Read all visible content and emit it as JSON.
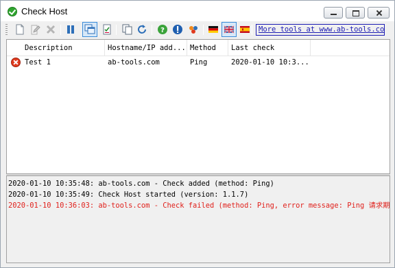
{
  "window": {
    "title": "Check Host"
  },
  "toolbar": {
    "buttons": [
      "new-document-icon",
      "edit-icon",
      "delete-icon",
      "pause-icon",
      "windows-icon",
      "checklist-icon",
      "copy-icon",
      "refresh-icon",
      "help-icon",
      "info-icon",
      "heart-icon",
      "flag-germany-icon",
      "flag-uk-icon",
      "flag-spain-icon"
    ],
    "active": [
      "windows-icon",
      "flag-uk-icon"
    ],
    "link_text": "More tools at www.ab-tools.com"
  },
  "list": {
    "columns": [
      "Description",
      "Hostname/IP add...",
      "Method",
      "Last check"
    ],
    "rows": [
      {
        "status": "error",
        "description": "Test 1",
        "host": "ab-tools.com",
        "method": "Ping",
        "last_check": "2020-01-10 10:3..."
      }
    ]
  },
  "log": {
    "lines": [
      {
        "text": "2020-01-10 10:35:48: ab-tools.com - Check added (method: Ping)",
        "level": "info"
      },
      {
        "text": "2020-01-10 10:35:49: Check Host started (version: 1.1.7)",
        "level": "info"
      },
      {
        "text": "2020-01-10 10:36:03: ab-tools.com - Check failed (method: Ping, error message: Ping 请求期间",
        "level": "error"
      }
    ]
  },
  "colors": {
    "error": "#e0201b",
    "link": "#1b1bb3",
    "ok": "#2fa52f"
  }
}
